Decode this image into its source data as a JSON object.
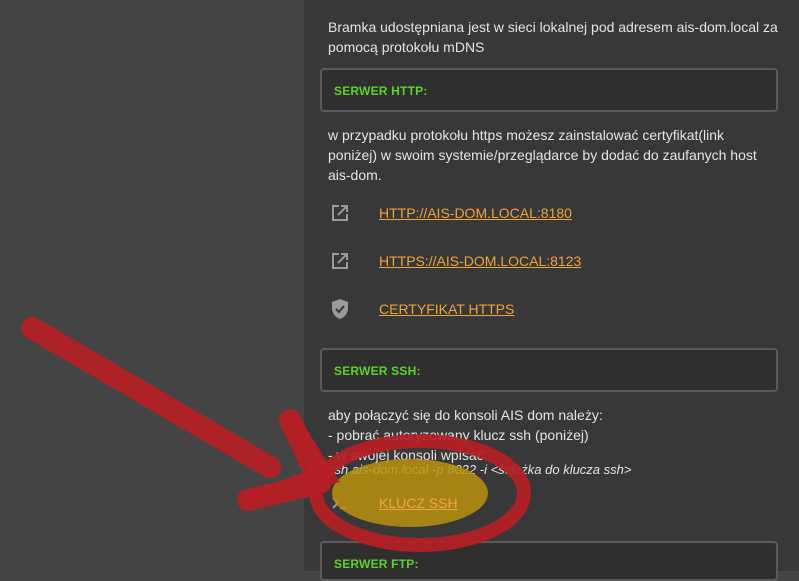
{
  "intro": {
    "line1": "Bramka udostępniana jest w sieci lokalnej pod adresem ais-dom.local za",
    "line2": "pomocą protokołu mDNS"
  },
  "http_section": {
    "title": "SERWER HTTP:",
    "desc_line1": "w przypadku protokołu https możesz zainstalować certyfikat(link",
    "desc_line2": "poniżej) w swoim systemie/przeglądarce by dodać do zaufanych host",
    "desc_line3": "ais-dom.",
    "links": [
      {
        "label": "HTTP://AIS-DOM.LOCAL:8180",
        "icon": "open-in-new-icon"
      },
      {
        "label": "HTTPS://AIS-DOM.LOCAL:8123",
        "icon": "open-in-new-icon"
      },
      {
        "label": "CERTYFIKAT HTTPS",
        "icon": "shield-check-icon"
      }
    ]
  },
  "ssh_section": {
    "title": "SERWER SSH:",
    "desc_line1": "aby połączyć się do konsoli AIS dom należy:",
    "desc_line2": "- pobrać autoryzowany klucz ssh (poniżej)",
    "desc_line3": "- w swojej konsoli wpisać:",
    "command": "ssh ais-dom.local -p 8022 -i <ścieżka do klucza ssh>",
    "link": {
      "label": "KLUCZ SSH",
      "icon": "console-icon"
    }
  },
  "ftp_section": {
    "title": "SERWER FTP:"
  },
  "colors": {
    "accent_green": "#5fd12f",
    "link_orange": "#f0a43a",
    "annotation_red": "#b52025",
    "highlight_gold": "#b8900f"
  }
}
